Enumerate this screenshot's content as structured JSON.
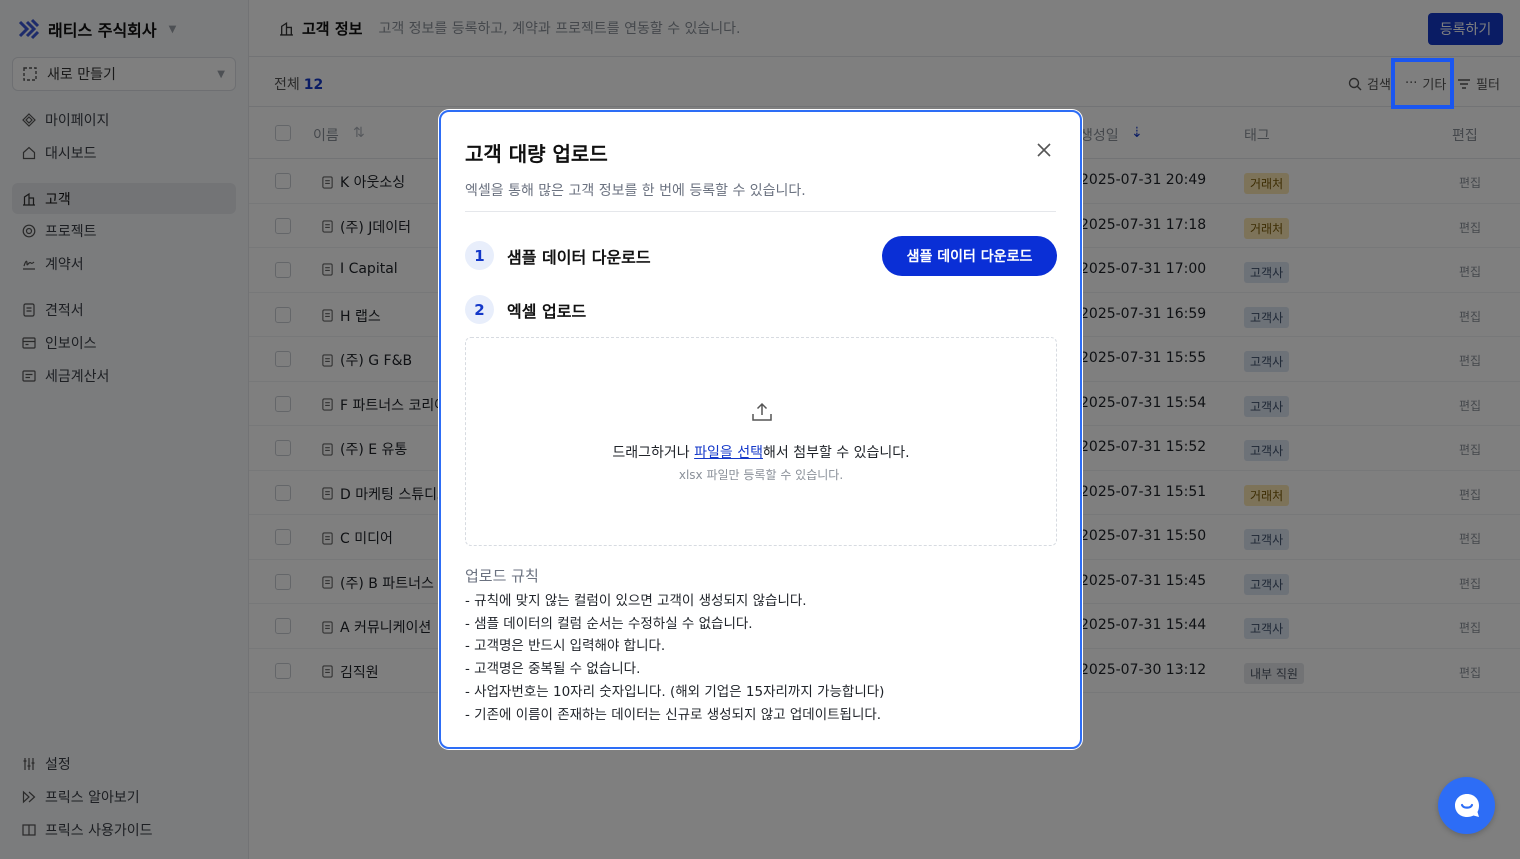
{
  "sidebar": {
    "brand": "래티스 주식회사",
    "new_button": "새로 만들기",
    "items": [
      {
        "label": "마이페이지",
        "icon": "diamond-icon"
      },
      {
        "label": "대시보드",
        "icon": "home-icon"
      },
      {
        "label": "고객",
        "icon": "building-icon"
      },
      {
        "label": "프로젝트",
        "icon": "target-icon"
      },
      {
        "label": "계약서",
        "icon": "signature-icon"
      },
      {
        "label": "견적서",
        "icon": "document-icon"
      },
      {
        "label": "인보이스",
        "icon": "invoice-icon"
      },
      {
        "label": "세금계산서",
        "icon": "receipt-icon"
      }
    ],
    "bottom_items": [
      {
        "label": "설정",
        "icon": "sliders-icon"
      },
      {
        "label": "프릭스 알아보기",
        "icon": "play-icon"
      },
      {
        "label": "프릭스 사용가이드",
        "icon": "book-icon"
      }
    ]
  },
  "header": {
    "title": "고객 정보",
    "description": "고객 정보를 등록하고, 계약과 프로젝트를 연동할 수 있습니다.",
    "register_button": "등록하기"
  },
  "subbar": {
    "total_label": "전체",
    "total_count": "12",
    "search_label": "검색",
    "more_label": "기타",
    "filter_label": "필터"
  },
  "table": {
    "columns": {
      "name": "이름",
      "created": "생성일",
      "tag": "태그",
      "edit": "편집"
    },
    "rows": [
      {
        "name": "K 아웃소싱",
        "created": "2025-07-31 20:49",
        "tag": "거래처",
        "tag_color": "yellow",
        "edit": "편집"
      },
      {
        "name": "(주) J데이터",
        "created": "2025-07-31 17:18",
        "tag": "거래처",
        "tag_color": "yellow",
        "edit": "편집"
      },
      {
        "name": "I Capital",
        "created": "2025-07-31 17:00",
        "tag": "고객사",
        "tag_color": "blue",
        "edit": "편집"
      },
      {
        "name": "H 랩스",
        "created": "2025-07-31 16:59",
        "tag": "고객사",
        "tag_color": "blue",
        "edit": "편집"
      },
      {
        "name": "(주) G F&B",
        "created": "2025-07-31 15:55",
        "tag": "고객사",
        "tag_color": "blue",
        "edit": "편집"
      },
      {
        "name": "F 파트너스 코리아",
        "created": "2025-07-31 15:54",
        "tag": "고객사",
        "tag_color": "blue",
        "edit": "편집"
      },
      {
        "name": "(주) E 유통",
        "created": "2025-07-31 15:52",
        "tag": "고객사",
        "tag_color": "blue",
        "edit": "편집"
      },
      {
        "name": "D 마케팅 스튜디오",
        "created": "2025-07-31 15:51",
        "tag": "거래처",
        "tag_color": "yellow",
        "edit": "편집"
      },
      {
        "name": "C 미디어",
        "created": "2025-07-31 15:50",
        "tag": "고객사",
        "tag_color": "blue",
        "edit": "편집"
      },
      {
        "name": "(주) B 파트너스",
        "created": "2025-07-31 15:45",
        "tag": "고객사",
        "tag_color": "blue",
        "edit": "편집"
      },
      {
        "name": "A 커뮤니케이션",
        "created": "2025-07-31 15:44",
        "tag": "고객사",
        "tag_color": "blue",
        "edit": "편집"
      },
      {
        "name": "김직원",
        "created": "2025-07-30 13:12",
        "tag": "내부 직원",
        "tag_color": "gray",
        "edit": "편집"
      }
    ]
  },
  "modal": {
    "title": "고객 대량 업로드",
    "subtitle": "엑셀을 통해 많은 고객 정보를 한 번에 등록할 수 있습니다.",
    "step1": {
      "num": "1",
      "label": "샘플 데이터 다운로드"
    },
    "step2": {
      "num": "2",
      "label": "엑셀 업로드"
    },
    "sample_button": "샘플 데이터 다운로드",
    "drop_prefix": "드래그하거나 ",
    "drop_link": "파일을 선택",
    "drop_suffix": "해서 첨부할 수 있습니다.",
    "drop_hint": "xlsx 파일만 등록할 수 있습니다.",
    "rules_title": "업로드 규칙",
    "rules": [
      "- 규칙에 맞지 않는 컬럼이 있으면 고객이 생성되지 않습니다.",
      "- 샘플 데이터의 컬럼 순서는 수정하실 수 없습니다.",
      "- 고객명은 반드시 입력해야 합니다.",
      "- 고객명은 중복될 수 없습니다.",
      "- 사업자번호는 10자리 숫자입니다. (해외 기업은 15자리까지 가능합니다)",
      "- 기존에 이름이 존재하는 데이터는 신규로 생성되지 않고 업데이트됩니다."
    ]
  },
  "colors": {
    "accent": "#1438c9",
    "highlight": "#1a56f0",
    "chat": "#2d6df6"
  }
}
